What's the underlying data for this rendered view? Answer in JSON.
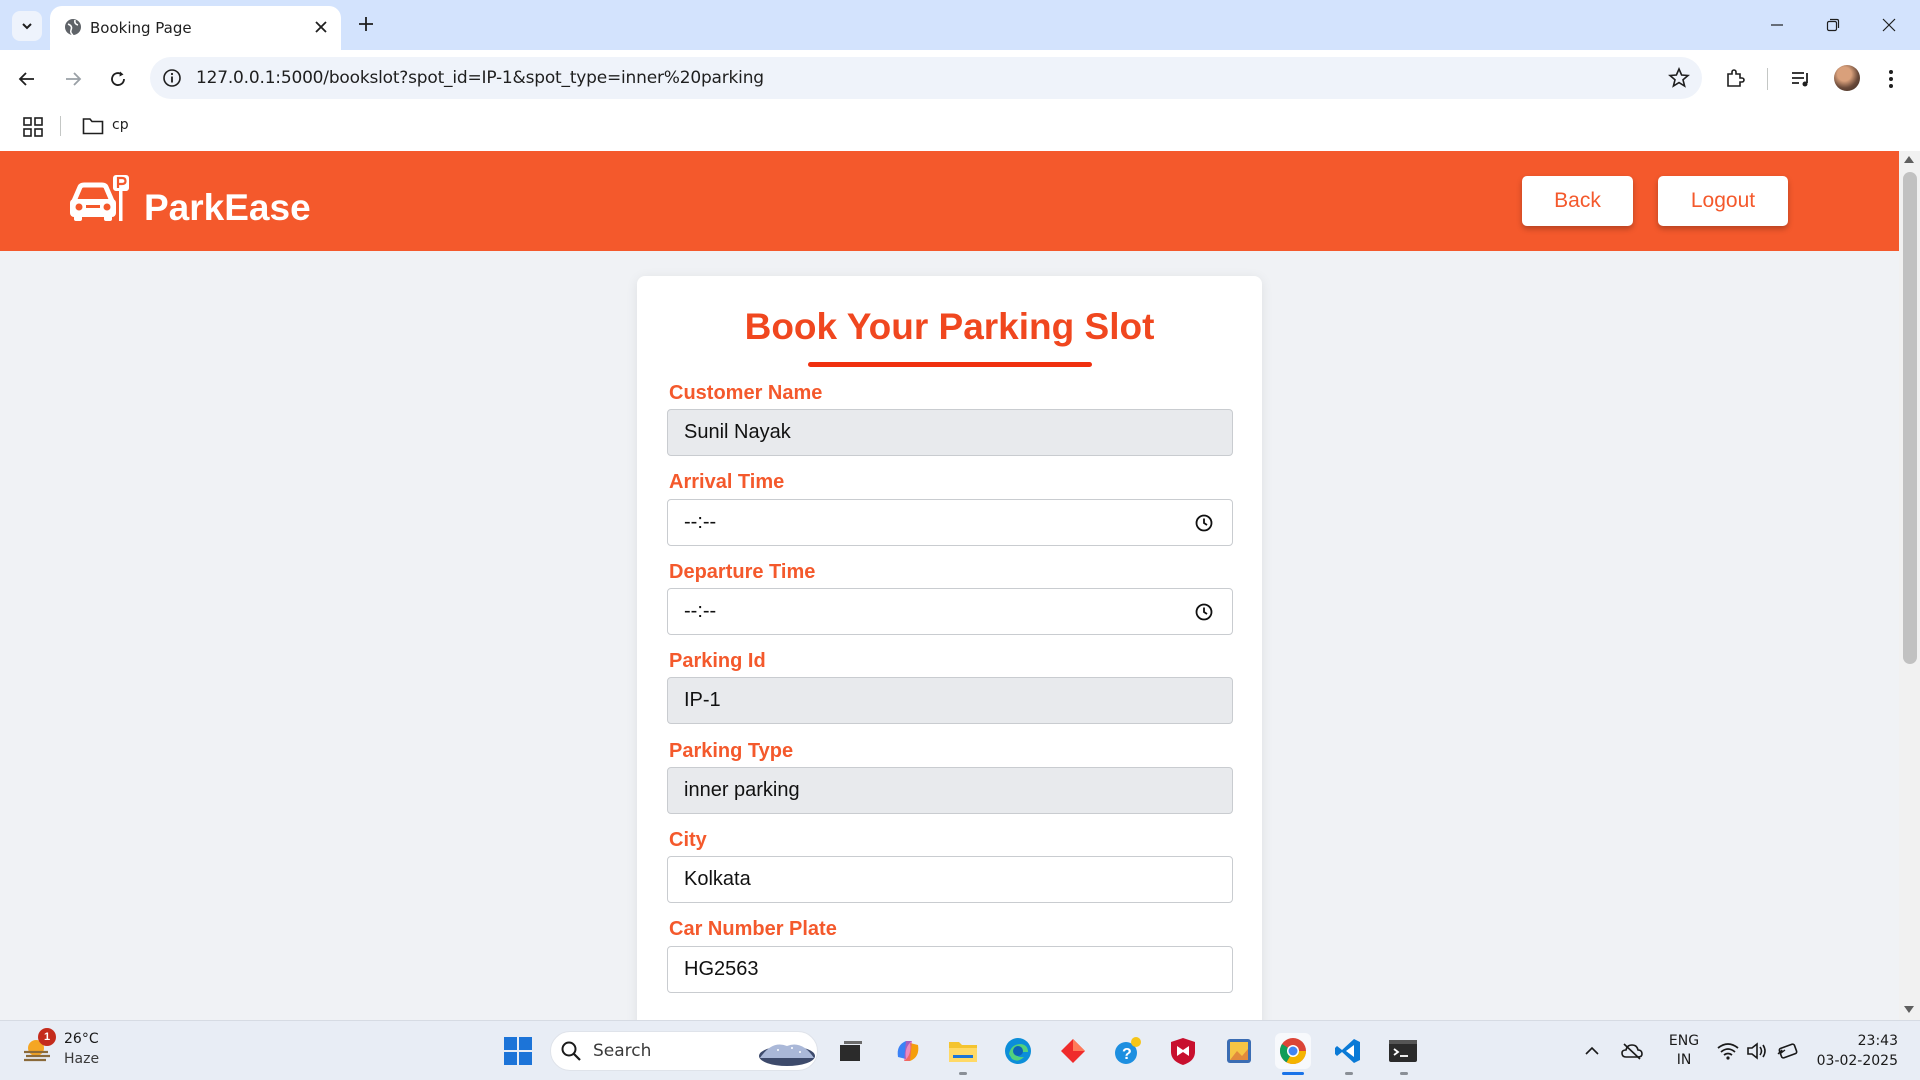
{
  "browser": {
    "tab_title": "Booking Page",
    "url": "127.0.0.1:5000/bookslot?spot_id=IP-1&spot_type=inner%20parking",
    "bookmarks": [
      {
        "label": "cp"
      }
    ]
  },
  "header": {
    "brand": "ParkEase",
    "back_label": "Back",
    "logout_label": "Logout",
    "color": "#f4592c"
  },
  "form": {
    "title": "Book Your Parking Slot",
    "fields": [
      {
        "label": "Customer Name",
        "value": "Sunil Nayak",
        "readonly": true
      },
      {
        "label": "Arrival Time",
        "value": "--:--",
        "type": "time"
      },
      {
        "label": "Departure Time",
        "value": "--:--",
        "type": "time"
      },
      {
        "label": "Parking Id",
        "value": "IP-1",
        "readonly": true
      },
      {
        "label": "Parking Type",
        "value": "inner parking",
        "readonly": true
      },
      {
        "label": "City",
        "value": "Kolkata"
      },
      {
        "label": "Car Number Plate",
        "value": "HG2563"
      }
    ]
  },
  "taskbar": {
    "weather_temp": "26°C",
    "weather_condition": "Haze",
    "weather_badge": "1",
    "search_label": "Search",
    "lang_line1": "ENG",
    "lang_line2": "IN",
    "time": "23:43",
    "date": "03-02-2025"
  }
}
